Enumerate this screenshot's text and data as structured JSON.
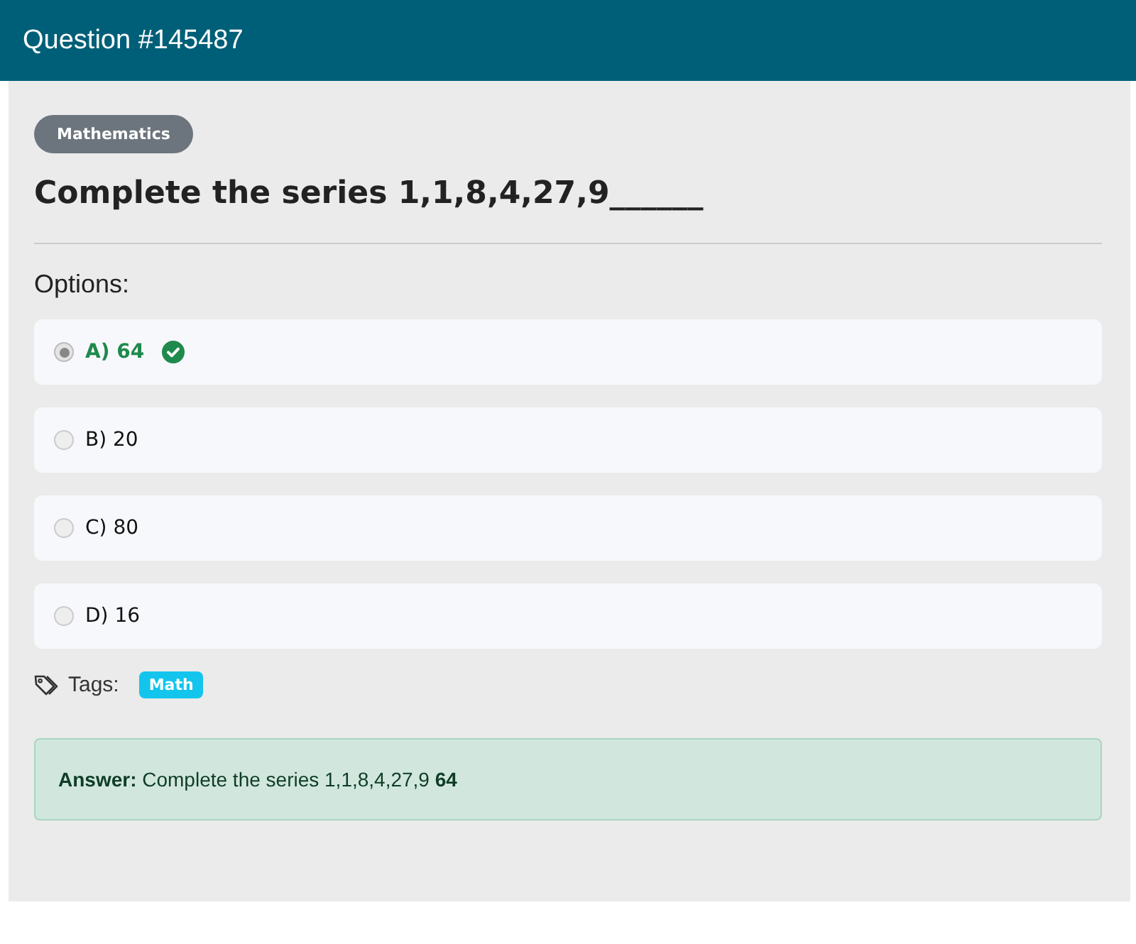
{
  "header": {
    "title": "Question #145487"
  },
  "category": "Mathematics",
  "question": "Complete the series 1,1,8,4,27,9______",
  "options_label": "Options:",
  "options": [
    {
      "label": "A) 64",
      "selected": true,
      "correct": true
    },
    {
      "label": "B) 20",
      "selected": false,
      "correct": false
    },
    {
      "label": "C) 80",
      "selected": false,
      "correct": false
    },
    {
      "label": "D) 16",
      "selected": false,
      "correct": false
    }
  ],
  "tags_label": "Tags:",
  "tags": [
    "Math"
  ],
  "answer": "**Answer:** Complete the series 1,1,8,4,27,9 **64**"
}
